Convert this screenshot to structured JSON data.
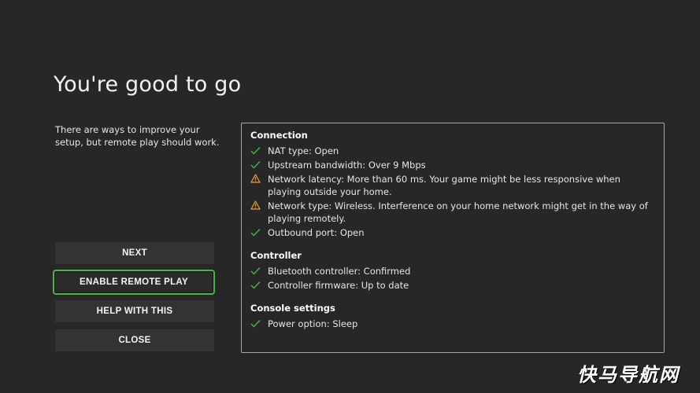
{
  "page": {
    "title": "You're good to go",
    "intro": "There are ways to improve your setup, but remote play should work."
  },
  "buttons": [
    {
      "label": "NEXT"
    },
    {
      "label": "ENABLE REMOTE PLAY"
    },
    {
      "label": "HELP WITH THIS"
    },
    {
      "label": "CLOSE"
    }
  ],
  "sections": [
    {
      "title": "Connection",
      "items": [
        {
          "status": "ok",
          "icon": "check-icon",
          "text": "NAT type: Open"
        },
        {
          "status": "ok",
          "icon": "check-icon",
          "text": "Upstream bandwidth: Over 9 Mbps"
        },
        {
          "status": "warn",
          "icon": "warning-icon",
          "text": "Network latency: More than 60 ms. Your game might be less responsive when playing outside your home."
        },
        {
          "status": "warn",
          "icon": "warning-icon",
          "text": "Network type: Wireless. Interference on your home network might get in the way of playing remotely."
        },
        {
          "status": "ok",
          "icon": "check-icon",
          "text": "Outbound port: Open"
        }
      ]
    },
    {
      "title": "Controller",
      "items": [
        {
          "status": "ok",
          "icon": "check-icon",
          "text": "Bluetooth controller: Confirmed"
        },
        {
          "status": "ok",
          "icon": "check-icon",
          "text": "Controller firmware: Up to date"
        }
      ]
    },
    {
      "title": "Console settings",
      "items": [
        {
          "status": "ok",
          "icon": "check-icon",
          "text": "Power option: Sleep"
        }
      ]
    }
  ],
  "colors": {
    "background": "#272727",
    "check": "#43b943",
    "warning": "#e8a33a",
    "focus": "#43b943"
  },
  "watermark": "快马导航网"
}
